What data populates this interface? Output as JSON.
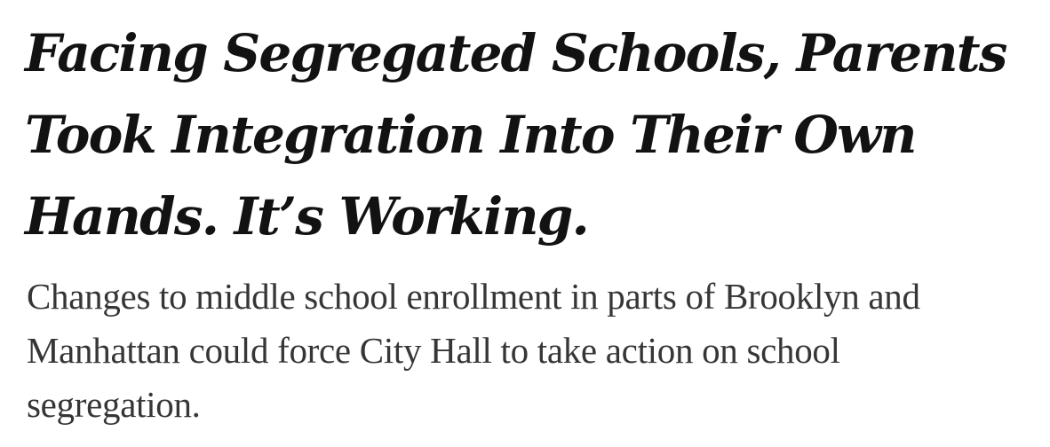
{
  "article": {
    "headline_lines": [
      "Facing Segregated Schools, Parents",
      "Took Integration Into Their Own",
      "Hands. It’s Working."
    ],
    "summary_lines": [
      "Changes to middle school enrollment in parts of Brooklyn and",
      "Manhattan could force City Hall to take action on school",
      "segregation."
    ]
  }
}
